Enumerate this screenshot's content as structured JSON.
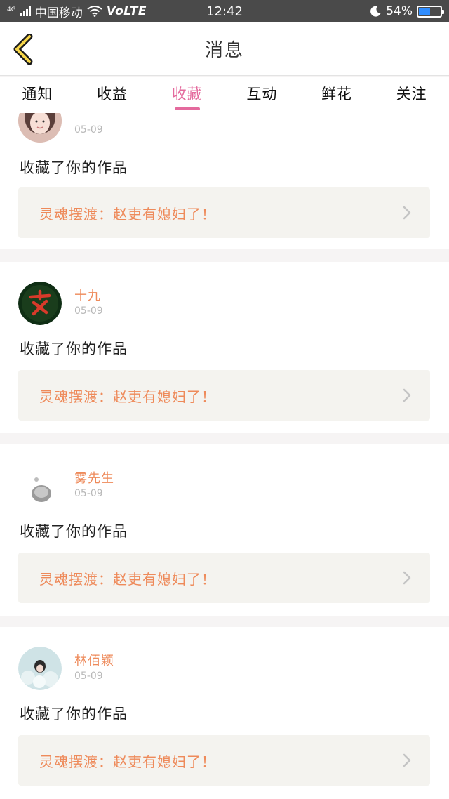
{
  "status_bar": {
    "network": "4G",
    "carrier": "中国移动",
    "volte": "VoLTE",
    "time": "12:42",
    "battery": "54%",
    "battery_level": 0.54
  },
  "header": {
    "title": "消息"
  },
  "tabs": [
    {
      "label": "通知"
    },
    {
      "label": "收益"
    },
    {
      "label": "收藏"
    },
    {
      "label": "互动"
    },
    {
      "label": "鲜花"
    },
    {
      "label": "关注"
    }
  ],
  "active_tab": "收藏",
  "feed": [
    {
      "username": "",
      "date": "05-09",
      "action": "收藏了你的作品",
      "work": "灵魂摆渡：赵吏有媳妇了！",
      "avatar": "girl-photo"
    },
    {
      "username": "十九",
      "date": "05-09",
      "action": "收藏了你的作品",
      "work": "灵魂摆渡：赵吏有媳妇了！",
      "avatar": "red-calligraphy-logo"
    },
    {
      "username": "雾先生",
      "date": "05-09",
      "action": "收藏了你的作品",
      "work": "灵魂摆渡：赵吏有媳妇了！",
      "avatar": "grey-figure"
    },
    {
      "username": "林佰颖",
      "date": "05-09",
      "action": "收藏了你的作品",
      "work": "灵魂摆渡：赵吏有媳妇了！",
      "avatar": "girl-in-bubbles"
    }
  ],
  "colors": {
    "accent": "#e46a9d",
    "username": "#ee8a5a",
    "work_title": "#ee8a5a",
    "status_bar": "#4a4a4a"
  }
}
